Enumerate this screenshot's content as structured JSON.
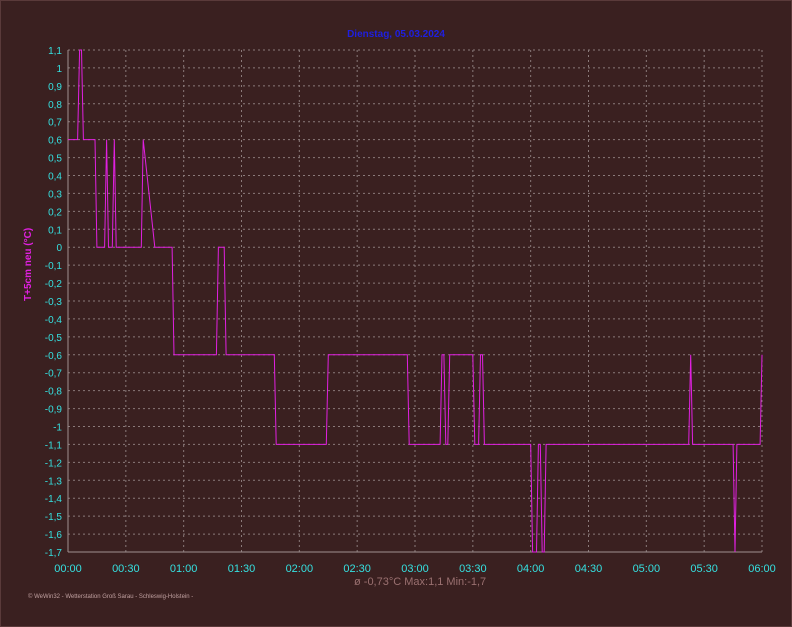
{
  "chart_data": {
    "type": "line",
    "title": "Dienstag, 05.03.2024",
    "ylabel": "T+5cm neu  (°C)",
    "xlabel": "",
    "ylim": [
      -1.7,
      1.1
    ],
    "xlim": [
      0,
      360
    ],
    "y_ticks": [
      "1,1",
      "1",
      "0,9",
      "0,8",
      "0,7",
      "0,6",
      "0,5",
      "0,4",
      "0,3",
      "0,2",
      "0,1",
      "0",
      "-0,1",
      "-0,2",
      "-0,3",
      "-0,4",
      "-0,5",
      "-0,6",
      "-0,7",
      "-0,8",
      "-0,9",
      "-1",
      "-1,1",
      "-1,2",
      "-1,3",
      "-1,4",
      "-1,5",
      "-1,6",
      "-1,7"
    ],
    "x_ticks": [
      "00:00",
      "00:30",
      "01:00",
      "01:30",
      "02:00",
      "02:30",
      "03:00",
      "03:30",
      "04:00",
      "04:30",
      "05:00",
      "05:30",
      "06:00"
    ],
    "grid": true,
    "series": [
      {
        "name": "T+5cm neu",
        "color": "#e020e0",
        "points": [
          [
            0,
            0.6
          ],
          [
            5,
            0.6
          ],
          [
            6,
            1.1
          ],
          [
            7,
            1.1
          ],
          [
            8,
            0.6
          ],
          [
            14,
            0.6
          ],
          [
            15,
            0
          ],
          [
            19,
            0
          ],
          [
            20,
            0.6
          ],
          [
            21,
            0
          ],
          [
            23,
            0
          ],
          [
            24,
            0.6
          ],
          [
            25,
            0
          ],
          [
            38,
            0
          ],
          [
            39,
            0.6
          ],
          [
            45,
            0
          ],
          [
            54,
            0
          ],
          [
            55,
            -0.6
          ],
          [
            77,
            -0.6
          ],
          [
            78,
            0
          ],
          [
            81,
            0
          ],
          [
            82,
            -0.6
          ],
          [
            107,
            -0.6
          ],
          [
            108,
            -1.1
          ],
          [
            134,
            -1.1
          ],
          [
            135,
            -0.6
          ],
          [
            176,
            -0.6
          ],
          [
            177,
            -1.1
          ],
          [
            193,
            -1.1
          ],
          [
            194,
            -0.6
          ],
          [
            195,
            -0.6
          ],
          [
            196,
            -1.1
          ],
          [
            197,
            -1.1
          ],
          [
            198,
            -0.6
          ],
          [
            210,
            -0.6
          ],
          [
            211,
            -1.1
          ],
          [
            213,
            -1.1
          ],
          [
            214,
            -0.6
          ],
          [
            215,
            -0.6
          ],
          [
            216,
            -1.1
          ],
          [
            240,
            -1.1
          ],
          [
            241,
            -1.7
          ],
          [
            243,
            -1.7
          ],
          [
            244,
            -1.1
          ],
          [
            245,
            -1.1
          ],
          [
            246,
            -1.7
          ],
          [
            247,
            -1.7
          ],
          [
            248,
            -1.1
          ],
          [
            322,
            -1.1
          ],
          [
            323,
            -0.6
          ],
          [
            324,
            -1.1
          ],
          [
            345,
            -1.1
          ],
          [
            346,
            -1.7
          ],
          [
            347,
            -1.1
          ],
          [
            359,
            -1.1
          ],
          [
            360,
            -0.6
          ]
        ]
      }
    ],
    "stats": "ø -0,73°C  Max:1,1  Min:-1,7",
    "footer": "© WeWin32 - Wetterstation Groß Sarau - Schleswig-Holstein -"
  }
}
